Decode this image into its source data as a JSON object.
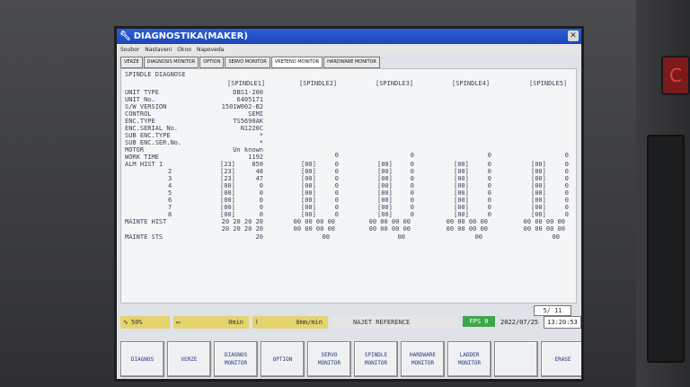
{
  "window": {
    "title": "DIAGNOSTIKA(MAKER)"
  },
  "menu": [
    "Soubor",
    "Nastaveni",
    "Okno",
    "Napoveda"
  ],
  "tabs": [
    {
      "label": "VERZE"
    },
    {
      "label": "DIAGNOSIS MONITOR"
    },
    {
      "label": "OPTION"
    },
    {
      "label": "SERVO MONITOR"
    },
    {
      "label": "VRETENO MONITOR",
      "active": true
    },
    {
      "label": "HARDWARE MONITOR"
    }
  ],
  "spindle": {
    "section_title": "SPINDLE DIAGNOSE",
    "headers": [
      "[SPINDLE1]",
      "[SPINDLE2]",
      "[SPINDLE3]",
      "[SPINDLE4]",
      "[SPINDLE5]"
    ],
    "info_labels": [
      "UNIT TYPE",
      "UNIT No.",
      "S/W VERSION",
      "CONTROL",
      "ENC.TYPE",
      "ENC.SERIAL No.",
      "SUB ENC.TYPE",
      "SUB ENC.SER.No.",
      "MOTOR",
      "WORK TIME"
    ],
    "info_values": [
      "DBS1-200",
      "6405171",
      "1501W002-B2",
      "SEMI",
      "TS5690AK",
      "N1220C",
      "*",
      "*",
      "Un known",
      "1192"
    ],
    "work_time_others": [
      "0",
      "0",
      "0",
      "0"
    ],
    "alm_label": "ALM HIST 1",
    "alm_indices": [
      "2",
      "3",
      "4",
      "5",
      "6",
      "7",
      "8"
    ],
    "alm_s1": [
      [
        "[23]",
        "850"
      ],
      [
        "[23]",
        "48"
      ],
      [
        "[23]",
        "47"
      ],
      [
        "[00]",
        "0"
      ],
      [
        "[00]",
        "0"
      ],
      [
        "[00]",
        "0"
      ],
      [
        "[00]",
        "0"
      ],
      [
        "[00]",
        "0"
      ]
    ],
    "alm_other": [
      "[00]",
      "0"
    ],
    "mainte_hist_label": "MAINTE HIST",
    "mainte_hist_s1": [
      "20 20 20 20",
      "20 20 20 20"
    ],
    "mainte_hist_other": [
      "00 00 00 00",
      "00 00 00 00"
    ],
    "mainte_sts_label": "MAINTE STS",
    "mainte_sts_s1": "20",
    "mainte_sts_other": "00"
  },
  "status": {
    "page": "5/ 11",
    "spindle_load": "50%",
    "spindle_speed": "0min",
    "feed": "0mm/min",
    "mode": "NAJET REFERENCE",
    "fps": "FPS 0",
    "date": "2022/07/25",
    "time": "13:20:53"
  },
  "softkeys": [
    "DIAGNOS",
    "VERZE",
    "DIAGNOS\nMONITOR",
    "OPTION",
    "SERVO\nMONITOR",
    "SPINDLE\nMONITOR",
    "HARDWARE\nMONITOR",
    "LADDER\nMONITOR",
    "",
    "ERASE"
  ]
}
